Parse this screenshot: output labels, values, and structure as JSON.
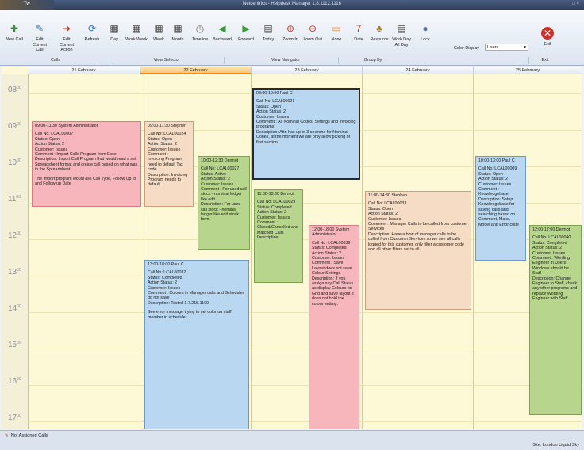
{
  "window": {
    "title": "Netcentrics - Helpdesk Manager 1.8.1112.1116",
    "corner_label": "Tw",
    "controls": "_ □ ×"
  },
  "ribbon": {
    "buttons": [
      {
        "label": "New Call",
        "icon": "new-call-icon",
        "glyph": "✚",
        "color": "#3b8a3e"
      },
      {
        "label": "Edit Current Call",
        "icon": "edit-call-icon",
        "glyph": "✎",
        "color": "#2f6fbf"
      },
      {
        "label": "Edit Current Action",
        "icon": "edit-action-icon",
        "glyph": "➜",
        "color": "#c0392b"
      },
      {
        "label": "Refresh",
        "icon": "refresh-icon",
        "glyph": "⟳",
        "color": "#2f6fbf"
      },
      {
        "label": "Day",
        "icon": "day-icon",
        "glyph": "▦",
        "color": "#444"
      },
      {
        "label": "Work Week",
        "icon": "work-week-icon",
        "glyph": "▦",
        "color": "#444"
      },
      {
        "label": "Week",
        "icon": "week-icon",
        "glyph": "▦",
        "color": "#444"
      },
      {
        "label": "Month",
        "icon": "month-icon",
        "glyph": "▦",
        "color": "#444"
      },
      {
        "label": "Timeline",
        "icon": "timeline-icon",
        "glyph": "◷",
        "color": "#666"
      },
      {
        "label": "Backward",
        "icon": "backward-icon",
        "glyph": "◀",
        "color": "#3b9a3e"
      },
      {
        "label": "Forward",
        "icon": "forward-icon",
        "glyph": "▶",
        "color": "#3b9a3e"
      },
      {
        "label": "Today",
        "icon": "today-icon",
        "glyph": "▤",
        "color": "#444"
      },
      {
        "label": "Zoom In",
        "icon": "zoom-in-icon",
        "glyph": "⊕",
        "color": "#c0392b"
      },
      {
        "label": "Zoom Out",
        "icon": "zoom-out-icon",
        "glyph": "⊖",
        "color": "#c0392b"
      },
      {
        "label": "None",
        "icon": "none-icon",
        "glyph": "▭",
        "color": "#e08a2c"
      },
      {
        "label": "Date",
        "icon": "date-icon",
        "glyph": "7",
        "color": "#c0392b"
      },
      {
        "label": "Resource",
        "icon": "resource-icon",
        "glyph": "♣",
        "color": "#b07a2c"
      },
      {
        "label": "Work Day All Day",
        "icon": "work-day-icon",
        "glyph": "▤",
        "color": "#444"
      },
      {
        "label": "Lock",
        "icon": "lock-icon",
        "glyph": "●",
        "color": "#5a6fa8"
      }
    ],
    "exit": {
      "label": "Exit",
      "icon": "exit-icon",
      "glyph": "✕"
    },
    "groups": [
      "Calls",
      "View Selector",
      "View Navigator",
      "Group By",
      "Exit"
    ],
    "color_display": {
      "label": "Color Display",
      "value": "Users"
    }
  },
  "days": [
    "21 February",
    "22 February",
    "23 February",
    "24 February",
    "25 February"
  ],
  "hours": [
    "08",
    "09",
    "10",
    "11",
    "12",
    "13",
    "14",
    "15",
    "16",
    "17"
  ],
  "hour_suffix": "00",
  "events": [
    {
      "color": "pink",
      "head": "09:00-11:30 System Administrator",
      "lines": [
        "Call No: LCAL00007",
        "Status: Open",
        "Action Status: 2",
        "Customer: Issues",
        "Comment : Import Calls Program from Excel",
        "Description: Import Call Program that would read a set Spreadsheet format and create call based on what was in the Spreadsheet"
      ],
      "extra": "The import program would ask Call Type, Follow Up to and Follow up Date"
    },
    {
      "color": "peach",
      "head": "09:00-11:30 Stephen",
      "lines": [
        "Call No: LCAL00024",
        "Status: Open",
        "Action Status: 2",
        "Customer: Issues",
        "Comment :",
        "Invoicing Program need to default Tax code",
        "Description: Invoicing Program needs to default"
      ],
      "extra": ""
    },
    {
      "color": "blue",
      "head": "13:00-18:00 Paul C",
      "lines": [
        "Call No: LCAL00032",
        "Status: Completed",
        "Action Status: 2",
        "Customer: Issues",
        "Comment : Colours in Manager calls and Scheduler do not save",
        "Description: Tested 1.7.215.1109"
      ],
      "extra": "See error message trying to set color on staff member in scheduler."
    },
    {
      "color": "green",
      "head": "10:00-12:30 Dermot",
      "lines": [
        "Call No: LCAL00027",
        "Status: Active",
        "Action Status: 2",
        "Customer: Issues",
        "Comment : For used call stock - nominal ledger like edit",
        "Description: For used call stock - nominal ledger like edit stock form."
      ],
      "extra": ""
    },
    {
      "color": "blue",
      "head": "08:00-10:00 Paul C",
      "lines": [
        "Call No: LCAL00021",
        "Status: Open",
        "Action Status: 2",
        "Customer: Issues",
        "Comment : All Nominal Codes, Settings and Invoicing programs",
        "Description: Attn has up to 3 sections for Nominal Codes, at the moment we are only allow picking of first section."
      ],
      "extra": ""
    },
    {
      "color": "green",
      "head": "11:00-13:00 Dermot",
      "lines": [
        "Call No: LCAL00029",
        "Status: Completed",
        "Action Status: 2",
        "Customer: Issues",
        "Comment : Closed/Cancelled and Matched Calls",
        "Description:"
      ],
      "extra": ""
    },
    {
      "color": "pink",
      "head": "12:00-18:00 System Administrator",
      "lines": [
        "Call No: LCAL00039",
        "Status: Completed",
        "Action Status: 2",
        "Customer: Issues",
        "Comment : Save Layout does not save Colour Settings",
        "Description: If you assign say Call Status as display Colours for Grid and save layout it does not hold the colour setting."
      ],
      "extra": ""
    },
    {
      "color": "peach",
      "head": "11:00-14:30 Stephen",
      "lines": [
        "Call No: LCAL00033",
        "Status: Open",
        "Action Status: 2",
        "Customer: Issues",
        "Comment : Manager Calls to be called from customer Services",
        "Description: Have a how of manager calls to be called from Customer Services so we see all calls logged for this customer, only filter a customer code and all other filters set to all."
      ],
      "extra": ""
    },
    {
      "color": "blue",
      "head": "10:00-13:00 Paul C",
      "lines": [
        "Call No: LCAL00009",
        "Status: Open",
        "Action Status: 2",
        "Customer: Issues",
        "Comment : Knowledgebase",
        "Description: Setup Knowledgebase for saving calls and searching based on Comment, Make, Model and Error code"
      ],
      "extra": ""
    },
    {
      "color": "green",
      "head": "12:00-17:00 Dermot",
      "lines": [
        "Call No: LCAL00040",
        "Status: Completed",
        "Action Status: 2",
        "Customer: Issues",
        "Comment : Wording Engineer in Users Windows should be Staff",
        "Description: Change Engineer to Staff, check any other programs and replace Wording Engineer with Staff"
      ],
      "extra": ""
    }
  ],
  "status": {
    "unassigned": "Not Assigned Calls",
    "site_label": "Site:",
    "site_value": "London Liquid Sky"
  }
}
